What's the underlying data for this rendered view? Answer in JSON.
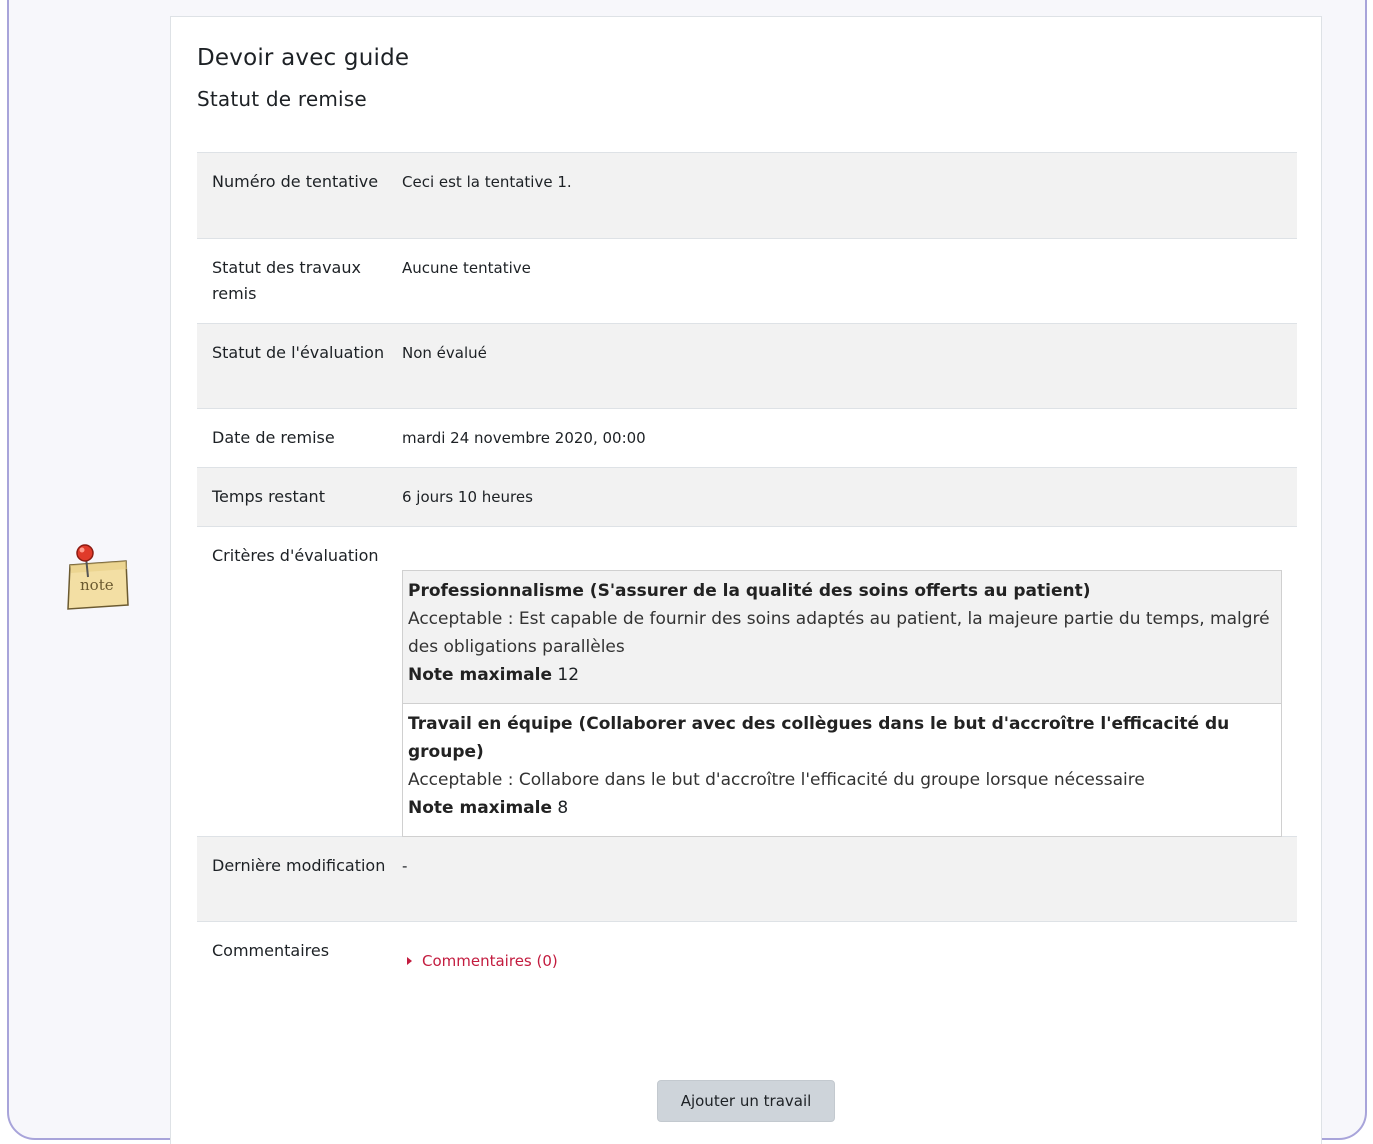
{
  "assignment": {
    "title": "Devoir avec guide",
    "section_title": "Statut de remise"
  },
  "status_rows": {
    "attempt": {
      "label": "Numéro de tentative",
      "value": "Ceci est la tentative 1."
    },
    "submission_status": {
      "label": "Statut des travaux remis",
      "value": "Aucune tentative"
    },
    "grading_status": {
      "label": "Statut de l'évaluation",
      "value": "Non évalué"
    },
    "due_date": {
      "label": "Date de remise",
      "value": "mardi 24 novembre 2020, 00:00"
    },
    "time_remaining": {
      "label": "Temps restant",
      "value": "6 jours 10 heures"
    },
    "criteria": {
      "label": "Critères d'évaluation",
      "items": [
        {
          "title": "Professionnalisme (S'assurer de la qualité des soins offerts au patient)",
          "text": "Acceptable : Est capable de fournir des soins adaptés au patient, la majeure partie du temps, malgré des obligations parallèles",
          "max_label": "Note maximale",
          "max_value": "12"
        },
        {
          "title": "Travail en équipe (Collaborer avec des collègues dans le but d'accroître l'efficacité du groupe)",
          "text": "Acceptable : Collabore dans le but d'accroître l'efficacité du groupe lorsque nécessaire",
          "max_label": "Note maximale",
          "max_value": "8"
        }
      ]
    },
    "last_modified": {
      "label": "Dernière modification",
      "value": "-"
    },
    "comments": {
      "label": "Commentaires",
      "link": "Commentaires (0)"
    }
  },
  "actions": {
    "add_submission": "Ajouter un travail"
  },
  "icons": {
    "note": "note-icon",
    "expand": "triangle-right-icon"
  },
  "colors": {
    "accent_link": "#c31c3f",
    "frame_border": "#a8a4da",
    "row_alt": "#f2f2f2"
  },
  "note_icon_text": "note"
}
